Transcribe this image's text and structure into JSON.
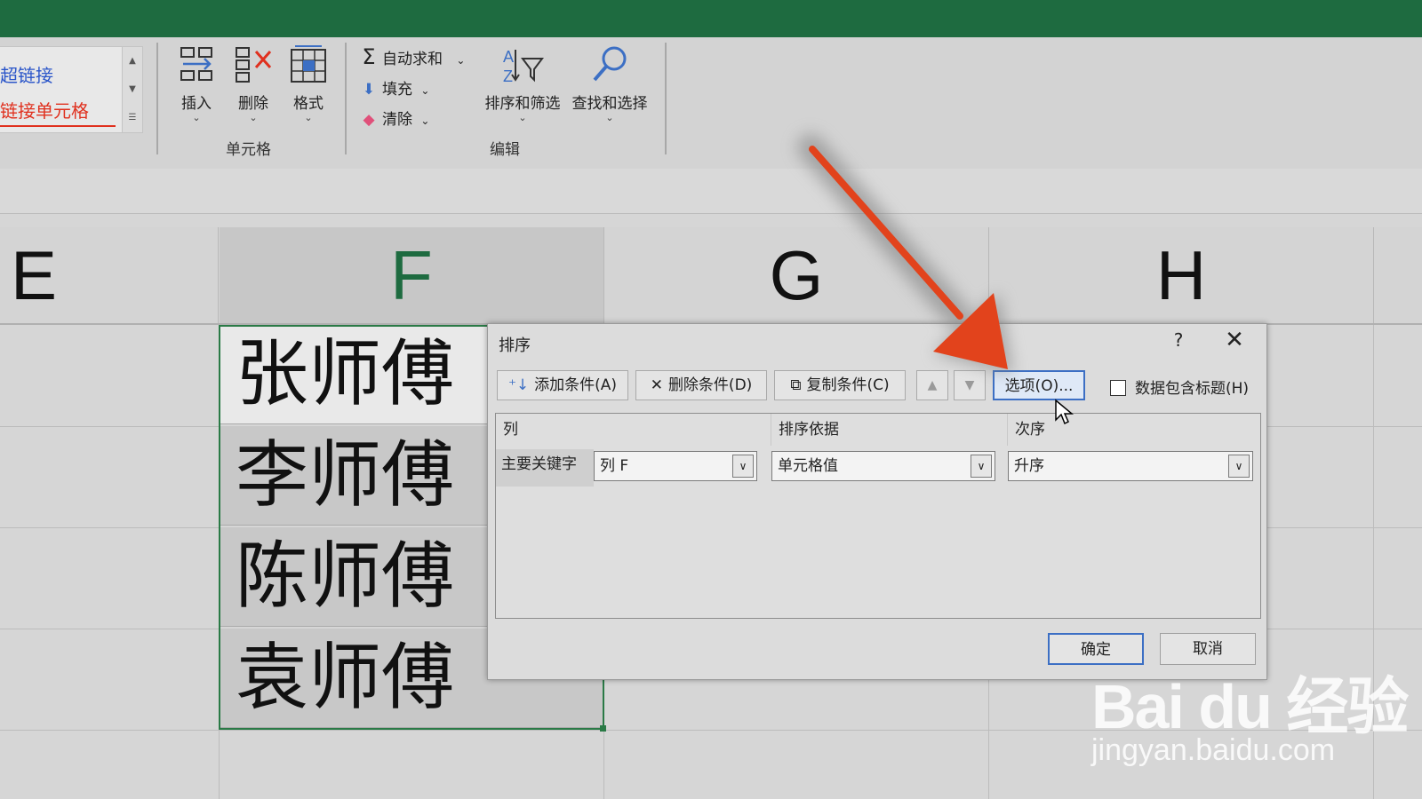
{
  "ribbon": {
    "styles": {
      "hyperlink": "超链接",
      "linked_cell": "链接单元格"
    },
    "cells_group": {
      "label": "单元格",
      "insert": "插入",
      "delete": "删除",
      "format": "格式"
    },
    "editing_group": {
      "label": "编辑",
      "autosum": "自动求和",
      "fill": "填充",
      "clear": "清除",
      "sort_filter": "排序和筛选",
      "find_select": "查找和选择"
    }
  },
  "sheet": {
    "columns": [
      "E",
      "F",
      "G",
      "H"
    ],
    "f_cells": [
      "张师傅",
      "李师傅",
      "陈师傅",
      "袁师傅"
    ]
  },
  "sort_dialog": {
    "title": "排序",
    "help": "?",
    "close": "✕",
    "toolbar": {
      "add_level": "添加条件(A)",
      "delete_level": "删除条件(D)",
      "copy_level": "复制条件(C)",
      "move_up": "▲",
      "move_down": "▼",
      "options": "选项(O)...",
      "has_headers": "数据包含标题(H)"
    },
    "table": {
      "headers": [
        "列",
        "排序依据",
        "次序"
      ],
      "row_label": "主要关键字",
      "column_value": "列 F",
      "sort_on_value": "单元格值",
      "order_value": "升序"
    },
    "ok": "确定",
    "cancel": "取消"
  },
  "watermark": {
    "logo": "Bai du 经验",
    "url": "jingyan.baidu.com"
  },
  "colors": {
    "excel_green": "#1e6b40",
    "annotation_arrow": "#e2431c",
    "focus_blue": "#3c6fc4"
  }
}
